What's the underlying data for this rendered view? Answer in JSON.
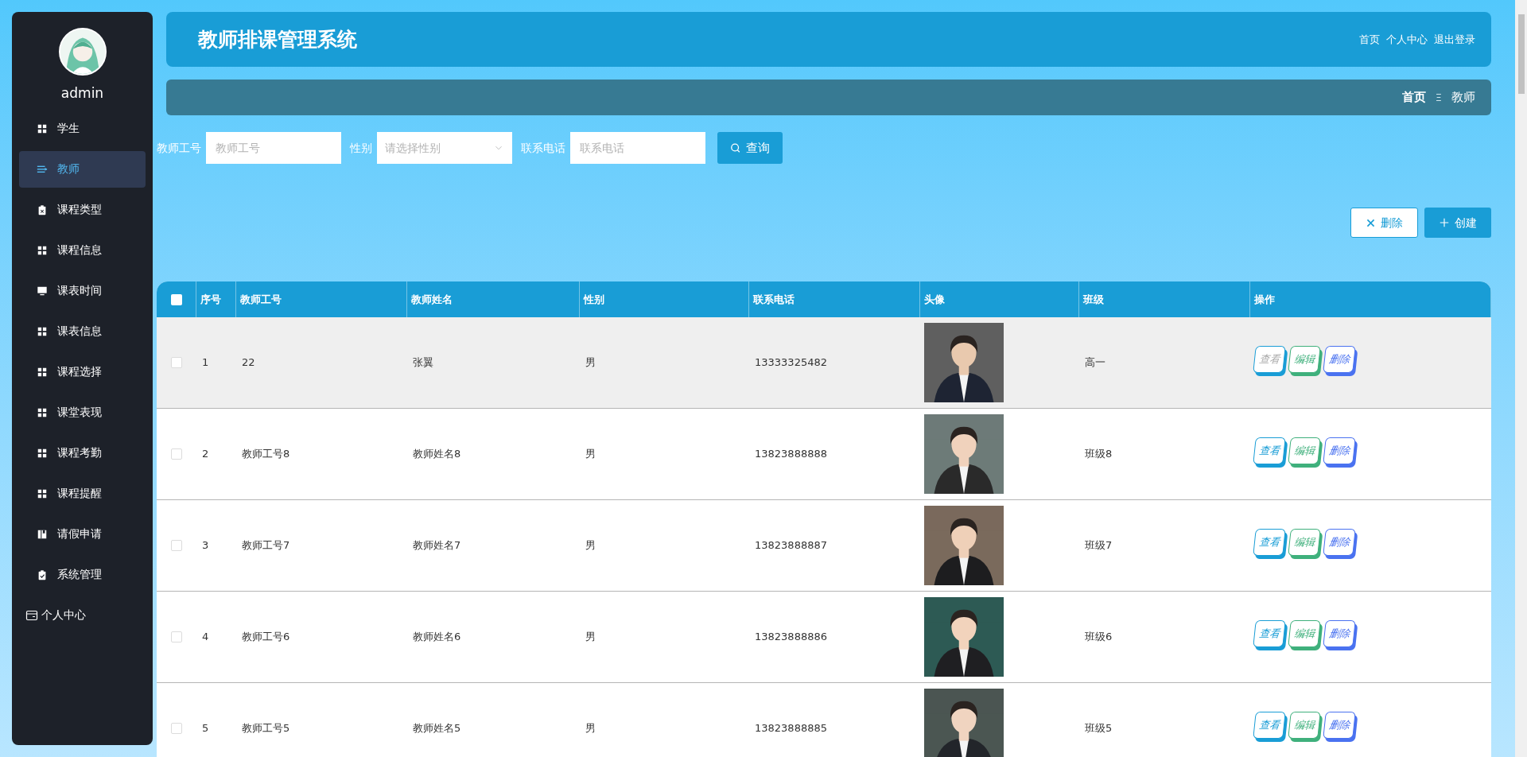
{
  "sidebar": {
    "user": "admin",
    "items": [
      {
        "label": "学生",
        "selected": false
      },
      {
        "label": "教师",
        "selected": true
      },
      {
        "label": "课程类型",
        "selected": false
      },
      {
        "label": "课程信息",
        "selected": false
      },
      {
        "label": "课表时间",
        "selected": false
      },
      {
        "label": "课表信息",
        "selected": false
      },
      {
        "label": "课程选择",
        "selected": false
      },
      {
        "label": "课堂表现",
        "selected": false
      },
      {
        "label": "课程考勤",
        "selected": false
      },
      {
        "label": "课程提醒",
        "selected": false
      },
      {
        "label": "请假申请",
        "selected": false
      },
      {
        "label": "系统管理",
        "selected": false
      }
    ],
    "personal": "个人中心"
  },
  "header": {
    "title": "教师排课管理系统",
    "links": [
      "首页",
      "个人中心",
      "退出登录"
    ]
  },
  "breadcrumb": {
    "home": "首页",
    "separator": "Ξ",
    "current": "教师"
  },
  "search": {
    "fields": [
      {
        "kind": "input",
        "label": "教师工号",
        "placeholder": "教师工号"
      },
      {
        "kind": "select",
        "label": "性别",
        "placeholder": "请选择性别"
      },
      {
        "kind": "input",
        "label": "联系电话",
        "placeholder": "联系电话"
      }
    ],
    "button": "查询"
  },
  "actions": {
    "delete": "删除",
    "create": "创建"
  },
  "table": {
    "columns": [
      "序号",
      "教师工号",
      "教师姓名",
      "性别",
      "联系电话",
      "头像",
      "班级",
      "操作"
    ],
    "select_all": {
      "checked": false
    },
    "rows": [
      {
        "index": "1",
        "id": "22",
        "name": "张翼",
        "gender": "男",
        "phone": "13333325482",
        "class": "高一",
        "hovered": true,
        "checked": false,
        "actions": [
          "查看",
          "编辑",
          "删除"
        ]
      },
      {
        "index": "2",
        "id": "教师工号8",
        "name": "教师姓名8",
        "gender": "男",
        "phone": "13823888888",
        "class": "班级8",
        "hovered": false,
        "checked": false,
        "actions": [
          "查看",
          "编辑",
          "删除"
        ]
      },
      {
        "index": "3",
        "id": "教师工号7",
        "name": "教师姓名7",
        "gender": "男",
        "phone": "13823888887",
        "class": "班级7",
        "hovered": false,
        "checked": false,
        "actions": [
          "查看",
          "编辑",
          "删除"
        ]
      },
      {
        "index": "4",
        "id": "教师工号6",
        "name": "教师姓名6",
        "gender": "男",
        "phone": "13823888886",
        "class": "班级6",
        "hovered": false,
        "checked": false,
        "actions": [
          "查看",
          "编辑",
          "删除"
        ]
      },
      {
        "index": "5",
        "id": "教师工号5",
        "name": "教师姓名5",
        "gender": "男",
        "phone": "13823888885",
        "class": "班级5",
        "hovered": false,
        "checked": false,
        "actions": [
          "查看",
          "编辑",
          "删除"
        ]
      }
    ]
  }
}
